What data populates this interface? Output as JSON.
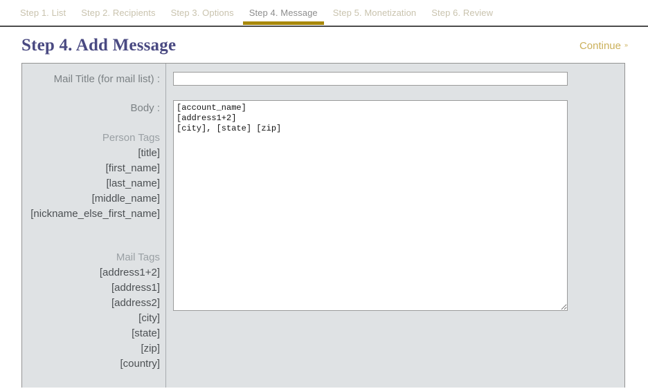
{
  "stepnav": {
    "tabs": [
      {
        "label": "Step 1. List",
        "active": false
      },
      {
        "label": "Step 2. Recipients",
        "active": false
      },
      {
        "label": "Step 3. Options",
        "active": false
      },
      {
        "label": "Step 4. Message",
        "active": true
      },
      {
        "label": "Step 5. Monetization",
        "active": false
      },
      {
        "label": "Step 6. Review",
        "active": false
      }
    ],
    "active_underline_color": "#a8880a"
  },
  "header": {
    "title": "Step 4. Add Message",
    "title_color": "#4a4a82",
    "continue_label": "Continue",
    "continue_chevrons": "»",
    "continue_color": "#cbb05a"
  },
  "form": {
    "mail_title": {
      "label": "Mail Title (for mail list) :",
      "value": "",
      "placeholder": ""
    },
    "body": {
      "label": "Body :",
      "value": "[account_name]\n[address1+2]\n[city], [state] [zip]",
      "placeholder": ""
    },
    "person_tags": {
      "heading": "Person Tags",
      "items": [
        "[title]",
        "[first_name]",
        "[last_name]",
        "[middle_name]",
        "[nickname_else_first_name]"
      ]
    },
    "mail_tags": {
      "heading": "Mail Tags",
      "items": [
        "[address1+2]",
        "[address1]",
        "[address2]",
        "[city]",
        "[state]",
        "[zip]",
        "[country]"
      ]
    },
    "panel_bg": "#dfe2e4",
    "panel_border": "#929292"
  }
}
